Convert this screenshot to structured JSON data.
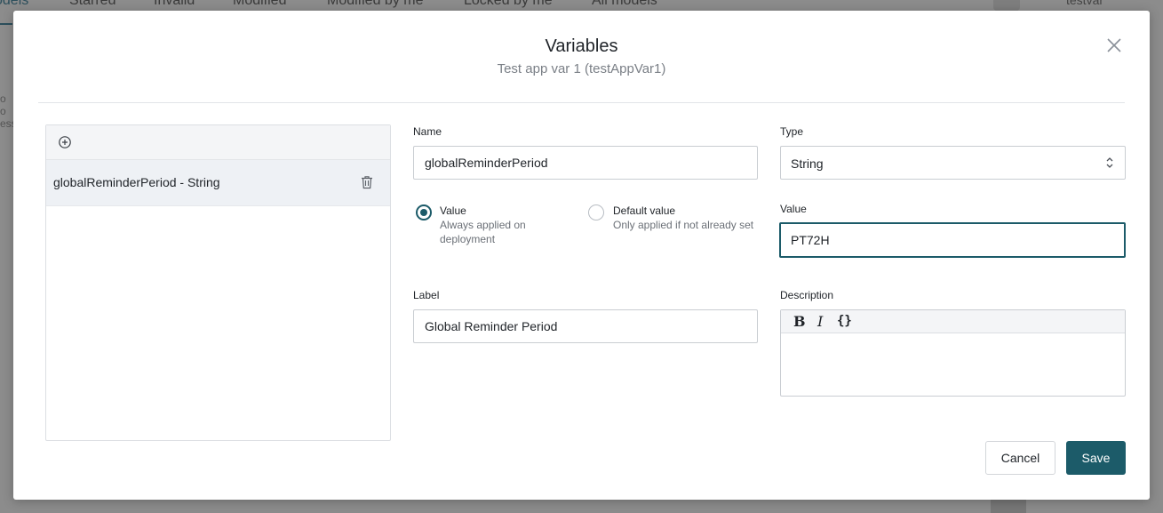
{
  "background": {
    "tabs": [
      "odels",
      "Starred",
      "Invalid",
      "Modified",
      "Modified by me",
      "Locked by me",
      "All models"
    ],
    "right_text": "testvar",
    "left_text_lines": [
      "o",
      "o",
      "ess"
    ]
  },
  "modal": {
    "title": "Variables",
    "subtitle": "Test app var 1 (testAppVar1)",
    "close_icon": "close-icon"
  },
  "list": {
    "add_icon": "add-circle-icon",
    "items": [
      {
        "label": "globalReminderPeriod - String",
        "delete_icon": "trash-icon"
      }
    ]
  },
  "form": {
    "name": {
      "label": "Name",
      "value": "globalReminderPeriod"
    },
    "type": {
      "label": "Type",
      "value": "String"
    },
    "value_mode": {
      "options": [
        {
          "title": "Value",
          "description": "Always applied on deployment",
          "checked": true
        },
        {
          "title": "Default value",
          "description": "Only applied if not already set",
          "checked": false
        }
      ]
    },
    "value": {
      "label": "Value",
      "value": "PT72H"
    },
    "label": {
      "label": "Label",
      "value": "Global Reminder Period"
    },
    "description": {
      "label": "Description",
      "toolbar": {
        "bold": "B",
        "italic": "I",
        "code": "{}"
      },
      "value": ""
    }
  },
  "footer": {
    "cancel_label": "Cancel",
    "save_label": "Save"
  },
  "colors": {
    "accent": "#1c5b69",
    "overlay": "#8c8c8c"
  }
}
